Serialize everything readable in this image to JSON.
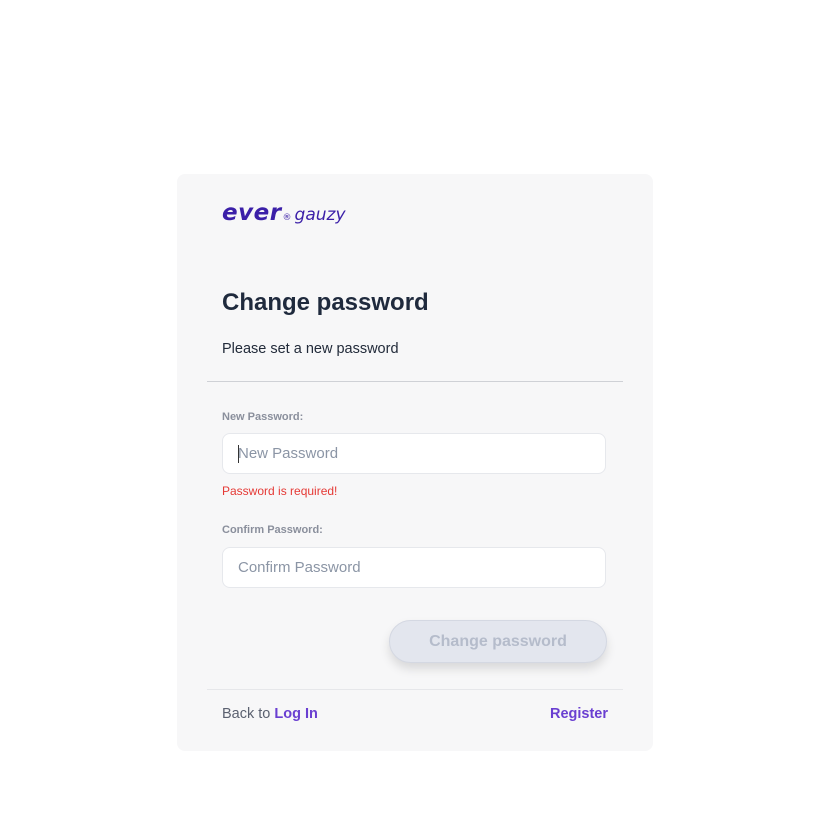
{
  "brand": {
    "logo_main": "ever",
    "logo_reg": "®",
    "logo_sub": "gauzy",
    "color": "#3b1fa8"
  },
  "form": {
    "title": "Change password",
    "subtitle": "Please set a new password",
    "new_password": {
      "label": "New Password:",
      "placeholder": "New Password",
      "value": "",
      "error": "Password is required!"
    },
    "confirm_password": {
      "label": "Confirm Password:",
      "placeholder": "Confirm Password",
      "value": ""
    },
    "submit_label": "Change password",
    "submit_disabled": true
  },
  "footer": {
    "back_prefix": "Back to",
    "login_link": "Log In",
    "register_link": "Register"
  },
  "colors": {
    "accent": "#6a3fd1",
    "error": "#e53935",
    "card_bg": "#f7f7f8"
  }
}
